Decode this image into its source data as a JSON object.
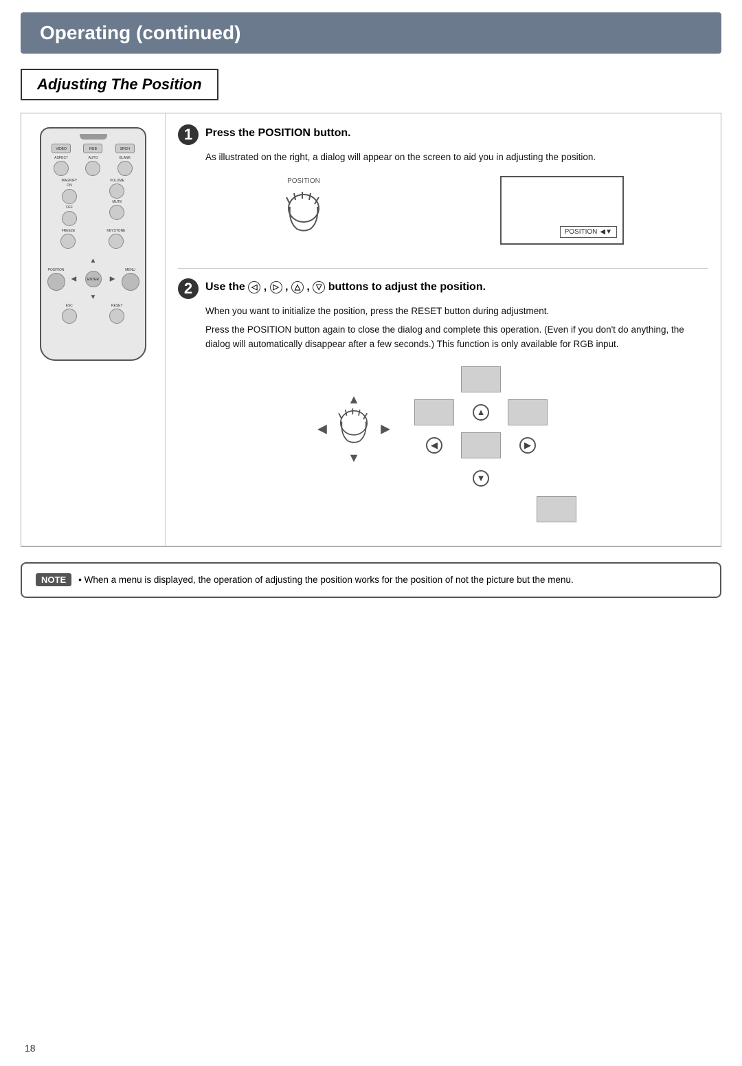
{
  "header": {
    "title": "Operating (continued)"
  },
  "section": {
    "title": "Adjusting The Position"
  },
  "step1": {
    "number": "1",
    "title": "Press the POSITION button.",
    "description": "As illustrated on the right, a dialog will appear on the screen to aid you in adjusting the position.",
    "position_label": "POSITION",
    "dialog_label": "POSITION"
  },
  "step2": {
    "number": "2",
    "title_part1": "Use the ",
    "title_arrows": "◁,▷,△,▽",
    "title_part2": " buttons to adjust the position.",
    "description1": "When you want to initialize the position, press the RESET button during adjustment.",
    "description2": "Press the POSITION button again to close the dialog and complete this operation.  (Even if you don't do anything, the dialog will automatically disappear after a few seconds.)  This function is only available for RGB input."
  },
  "note": {
    "label": "NOTE",
    "bullet": "•",
    "text": "When a menu is displayed, the operation of adjusting the position works for the position of not the picture but the menu."
  },
  "page_number": "18",
  "remote": {
    "buttons": [
      "VIDEO",
      "RGB",
      "SEARCH",
      "ASPECT",
      "AUTO",
      "BLANK",
      "MAGNIFY",
      "VOLUME",
      "ON",
      "MUTE",
      "OFF",
      "FREEZE",
      "KEYSTONE",
      "POSITION",
      "MENU",
      "ESC",
      "RESET"
    ]
  }
}
